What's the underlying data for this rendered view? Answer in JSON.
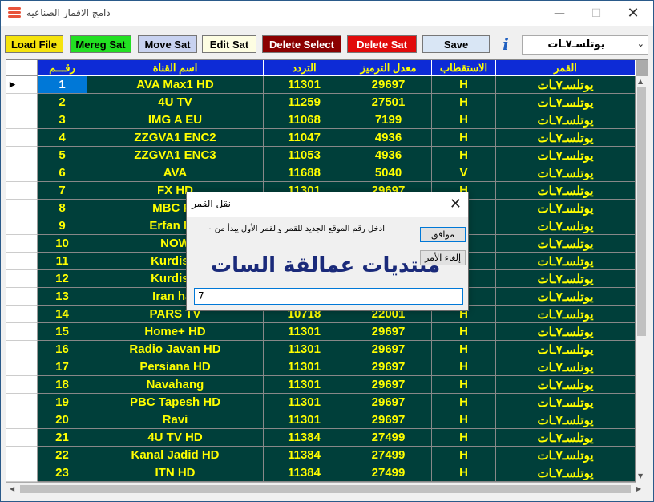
{
  "window": {
    "title": "دامج الاقمار الصناعيه"
  },
  "toolbar": {
    "buttons": [
      {
        "label": "Load File",
        "bg": "#f5e30c",
        "fg": "#000000"
      },
      {
        "label": "Mereg Sat",
        "bg": "#22e022",
        "fg": "#000000"
      },
      {
        "label": "Move Sat",
        "bg": "#c8d2f0",
        "fg": "#000000"
      },
      {
        "label": "Edit Sat",
        "bg": "#fdfde2",
        "fg": "#000000"
      },
      {
        "label": "Delete Select",
        "bg": "#8b0000",
        "fg": "#ffffff"
      },
      {
        "label": "Delete Sat",
        "bg": "#e10b0b",
        "fg": "#ffffff"
      },
      {
        "label": "Save",
        "bg": "#d9e6f5",
        "fg": "#000000"
      }
    ],
    "info_label": "i",
    "satellite_select": {
      "value": "يوتلسـ٧ـات"
    }
  },
  "grid": {
    "columns": [
      "رقـــم",
      "اسم القناة",
      "التردد",
      "معدل الترميز",
      "الاستقطاب",
      "القمر"
    ],
    "rows": [
      [
        "1",
        "AVA Max1 HD",
        "11301",
        "29697",
        "H",
        "يوتلسـ٧ـات"
      ],
      [
        "2",
        "4U TV",
        "11259",
        "27501",
        "H",
        "يوتلسـ٧ـات"
      ],
      [
        "3",
        "IMG A EU",
        "11068",
        "7199",
        "H",
        "يوتلسـ٧ـات"
      ],
      [
        "4",
        "ZZGVA1 ENC2",
        "11047",
        "4936",
        "H",
        "يوتلسـ٧ـات"
      ],
      [
        "5",
        "ZZGVA1 ENC3",
        "11053",
        "4936",
        "H",
        "يوتلسـ٧ـات"
      ],
      [
        "6",
        "AVA",
        "11688",
        "5040",
        "V",
        "يوتلسـ٧ـات"
      ],
      [
        "7",
        "FX HD",
        "11301",
        "29697",
        "H",
        "يوتلسـ٧ـات"
      ],
      [
        "8",
        "MBC Pe",
        "",
        "",
        "",
        "يوتلسـ٧ـات"
      ],
      [
        "9",
        "Erfan hal",
        "",
        "",
        "",
        "يوتلسـ٧ـات"
      ],
      [
        "10",
        "NOW",
        "",
        "",
        "",
        "يوتلسـ٧ـات"
      ],
      [
        "11",
        "Kurdista",
        "",
        "",
        "",
        "يوتلسـ٧ـات"
      ],
      [
        "12",
        "Kurdista",
        "",
        "",
        "",
        "يوتلسـ٧ـات"
      ],
      [
        "13",
        "Iran haz",
        "",
        "",
        "",
        "يوتلسـ٧ـات"
      ],
      [
        "14",
        "PARS TV",
        "10718",
        "22001",
        "H",
        "يوتلسـ٧ـات"
      ],
      [
        "15",
        "Home+ HD",
        "11301",
        "29697",
        "H",
        "يوتلسـ٧ـات"
      ],
      [
        "16",
        "Radio Javan HD",
        "11301",
        "29697",
        "H",
        "يوتلسـ٧ـات"
      ],
      [
        "17",
        "Persiana HD",
        "11301",
        "29697",
        "H",
        "يوتلسـ٧ـات"
      ],
      [
        "18",
        "Navahang",
        "11301",
        "29697",
        "H",
        "يوتلسـ٧ـات"
      ],
      [
        "19",
        "PBC Tapesh HD",
        "11301",
        "29697",
        "H",
        "يوتلسـ٧ـات"
      ],
      [
        "20",
        "Ravi",
        "11301",
        "29697",
        "H",
        "يوتلسـ٧ـات"
      ],
      [
        "21",
        "4U TV HD",
        "11384",
        "27499",
        "H",
        "يوتلسـ٧ـات"
      ],
      [
        "22",
        "Kanal Jadid HD",
        "11384",
        "27499",
        "H",
        "يوتلسـ٧ـات"
      ],
      [
        "23",
        "ITN HD",
        "11384",
        "27499",
        "H",
        "يوتلسـ٧ـات"
      ]
    ],
    "selected_row": 0
  },
  "dialog": {
    "title": "نقل القمر",
    "message": "ادخل رقم الموقع الجديد للقمر والقمر الأول يبدأ من ٠",
    "banner": "منتديات عمالقة السات",
    "ok_label": "موافق",
    "cancel_label": "إلغاء الأمر",
    "input_value": "7"
  }
}
